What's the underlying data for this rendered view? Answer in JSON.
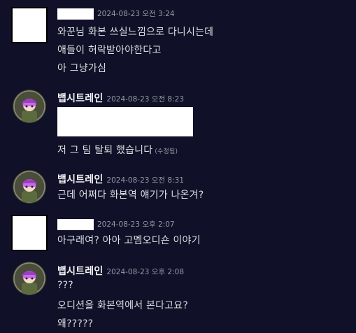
{
  "messages": [
    {
      "timestamp": "2024-08-23 오전 3:24",
      "lines": [
        "와꾼님 화본 쓰실느낌으로 다니시는데",
        "애들이 허락받아야한다고",
        "아 그냥가심"
      ]
    },
    {
      "username": "뱁시트레인",
      "timestamp": "2024-08-23 오전 8:23",
      "lines": [
        "저 그 팀 탈퇴 했습니다"
      ],
      "edited_label": "(수정됨)"
    },
    {
      "username": "뱁시트레인",
      "timestamp": "2024-08-23 오전 8:31",
      "lines": [
        "근데 어쩌다 화본역 얘기가 나온겨?"
      ]
    },
    {
      "timestamp": "2024-08-23 오후 2:07",
      "lines": [
        "아구래여? 아아 고멤오디숀 이야기"
      ]
    },
    {
      "username": "뱁시트레인",
      "timestamp": "2024-08-23 오후 2:08",
      "lines": [
        "???",
        "오디션을 화본역에서 본다고요?",
        "왜?????"
      ]
    }
  ],
  "colors": {
    "background": "#101028",
    "username": "#f2f3f5",
    "timestamp": "#949ba4",
    "text": "#dbdee1"
  }
}
